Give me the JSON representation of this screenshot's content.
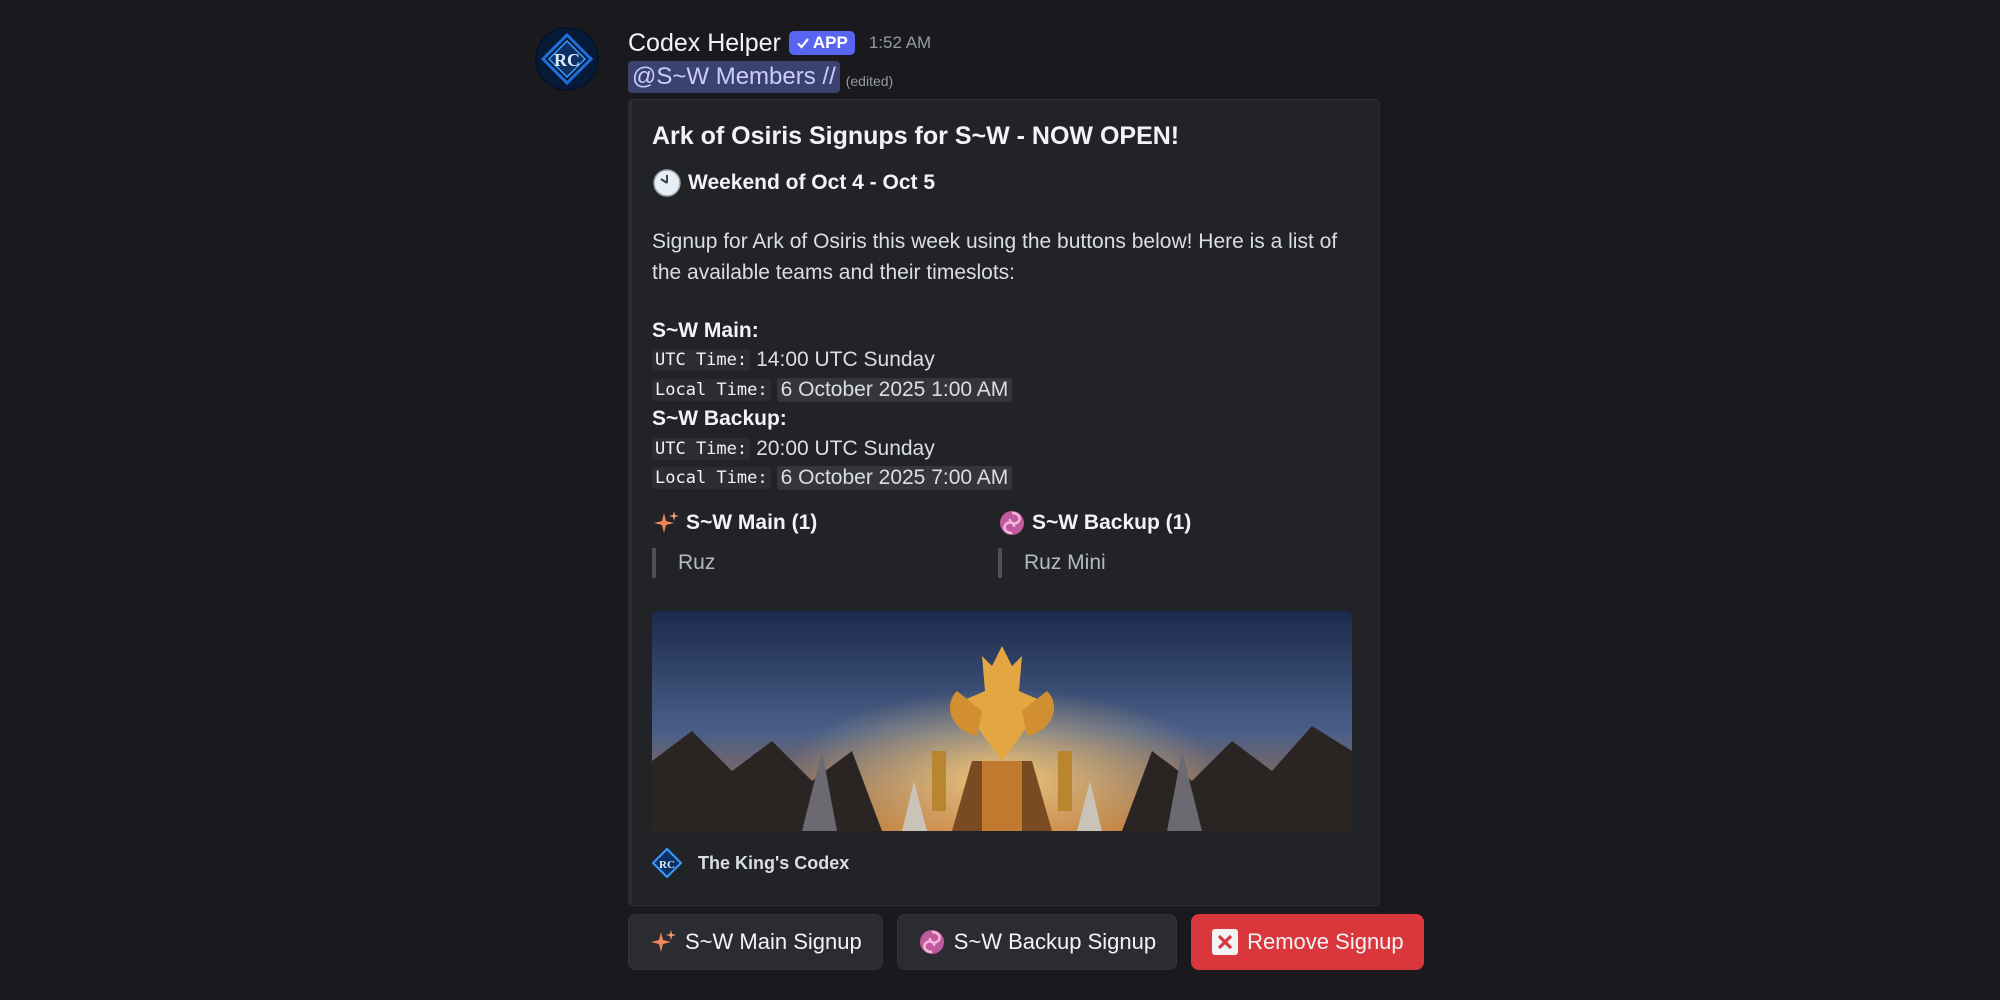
{
  "message": {
    "author": "Codex Helper",
    "badge": "APP",
    "time": "1:52 AM",
    "mention": "@S~W Members //",
    "edited": "(edited)"
  },
  "embed": {
    "title": "Ark of Osiris Signups for S~W - NOW OPEN!",
    "week": "Weekend of Oct 4 - Oct 5",
    "description": "Signup for Ark of Osiris this week using the buttons below! Here is a list of the available teams and their timeslots:",
    "teams": [
      {
        "name": "S~W Main:",
        "utc_label": "UTC Time:",
        "utc_value": "14:00 UTC Sunday",
        "local_label": "Local Time:",
        "local_value": "6 October 2025 1:00 AM"
      },
      {
        "name": "S~W Backup:",
        "utc_label": "UTC Time:",
        "utc_value": "20:00 UTC Sunday",
        "local_label": "Local Time:",
        "local_value": "6 October 2025 7:00 AM"
      }
    ],
    "fields": [
      {
        "name": "S~W Main (1)",
        "value": "Ruz",
        "icon": "sparkles-icon"
      },
      {
        "name": "S~W Backup (1)",
        "value": "Ruz Mini",
        "icon": "swirl-icon"
      }
    ],
    "footer": "The King's Codex"
  },
  "buttons": {
    "main_signup": "S~W Main Signup",
    "backup_signup": "S~W Backup Signup",
    "remove_signup": "Remove Signup"
  },
  "colors": {
    "background": "#1a1a1e",
    "embed_bg": "#222327",
    "blurple": "#5865f2",
    "danger": "#da373c",
    "mention_bg": "#3c4270"
  }
}
